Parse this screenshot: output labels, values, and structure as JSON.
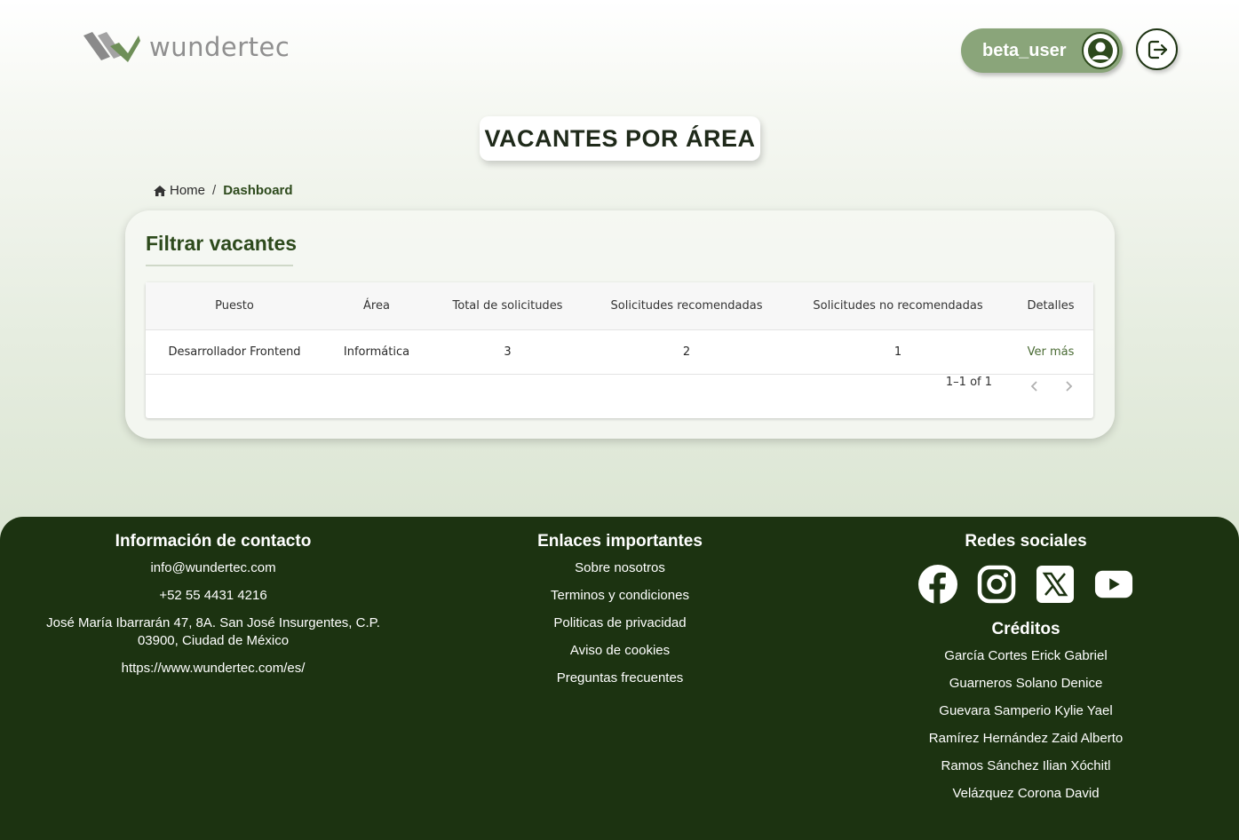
{
  "brand": {
    "name": "wundertec"
  },
  "header": {
    "username": "beta_user"
  },
  "page": {
    "title": "VACANTES POR ÁREA"
  },
  "breadcrumb": {
    "home": "Home",
    "separator": "/",
    "current": "Dashboard"
  },
  "card": {
    "title": "Filtrar vacantes",
    "table": {
      "columns": [
        "Puesto",
        "Área",
        "Total de solicitudes",
        "Solicitudes recomendadas",
        "Solicitudes no recomendadas",
        "Detalles"
      ],
      "rows": [
        [
          "Desarrollador Frontend",
          "Informática",
          "3",
          "2",
          "1",
          "Ver más"
        ]
      ]
    },
    "pagination": {
      "text": "1–1 of 1"
    }
  },
  "footer": {
    "contact": {
      "title": "Información de contacto",
      "email": "info@wundertec.com",
      "phone": "+52 55 4431 4216",
      "address": "José María Ibarrarán 47, 8A. San José Insurgentes, C.P. 03900, Ciudad de México",
      "website": "https://www.wundertec.com/es/"
    },
    "links": {
      "title": "Enlaces importantes",
      "items": [
        "Sobre nosotros",
        "Terminos y condiciones",
        "Politicas de privacidad",
        "Aviso de cookies",
        "Preguntas frecuentes"
      ]
    },
    "social": {
      "title": "Redes sociales",
      "icons": [
        "facebook-icon",
        "instagram-icon",
        "x-icon",
        "youtube-icon"
      ]
    },
    "credits": {
      "title": "Créditos",
      "names": [
        "García Cortes Erick Gabriel",
        "Guarneros Solano Denice",
        "Guevara Samperio Kylie Yael",
        "Ramírez Hernández Zaid Alberto",
        "Ramos Sánchez Ilian Xóchitl",
        "Velázquez Corona David"
      ]
    }
  },
  "colors": {
    "accent": "#8aa57a",
    "dark_green": "#1c3311",
    "title_green": "#2d4a1c"
  }
}
